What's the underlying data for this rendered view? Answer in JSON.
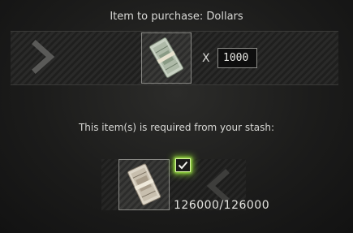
{
  "purchase": {
    "title": "Item to purchase: Dollars",
    "multiplier_symbol": "X",
    "quantity": "1000",
    "item_icon": "dollars-icon"
  },
  "requirement": {
    "label": "This item(s) is required from your stash:",
    "count_text": "126000/126000",
    "item_icon": "rubles-icon",
    "checked": true,
    "check_color": "#9be635"
  },
  "icons": {
    "navigation": "chevron-left-icon",
    "check": "check-icon"
  }
}
